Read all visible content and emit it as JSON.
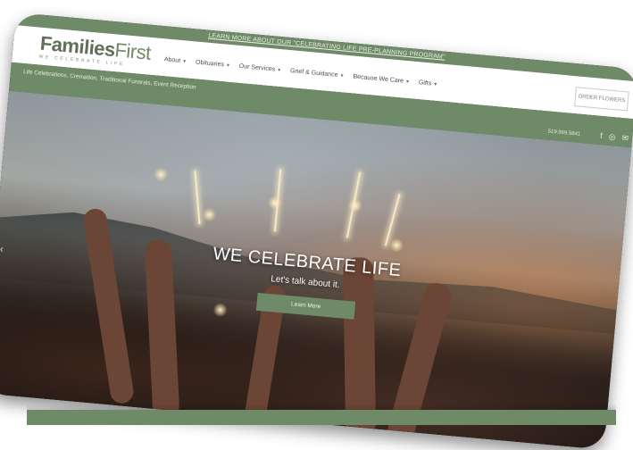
{
  "topbar": {
    "text": "LEARN MORE ABOUT OUR \"CELEBRATING LIFE PRE-PLANNING PROGRAM\""
  },
  "logo": {
    "brand_a": "Families",
    "brand_b": "First",
    "tagline": "WE CELEBRATE LIFE"
  },
  "menu": [
    {
      "label": "About"
    },
    {
      "label": "Obituaries"
    },
    {
      "label": "Our Services"
    },
    {
      "label": "Grief & Guidance"
    },
    {
      "label": "Because We Care"
    },
    {
      "label": "Gifts"
    }
  ],
  "order_button": "ORDER FLOWERS",
  "subbar": {
    "services": "Life Celebrations, Cremation, Traditional Funerals, Event Reception",
    "phone": "519.969.5841"
  },
  "social": {
    "facebook": "f",
    "instagram": "◎",
    "email": "✉"
  },
  "hero": {
    "title": "WE CELEBRATE LIFE",
    "subtitle": "Let's talk about it.",
    "button": "Learn More",
    "prev_arrow": "‹"
  },
  "colors": {
    "brand_green": "#6e8a66",
    "logo_green": "#5e6f56"
  }
}
